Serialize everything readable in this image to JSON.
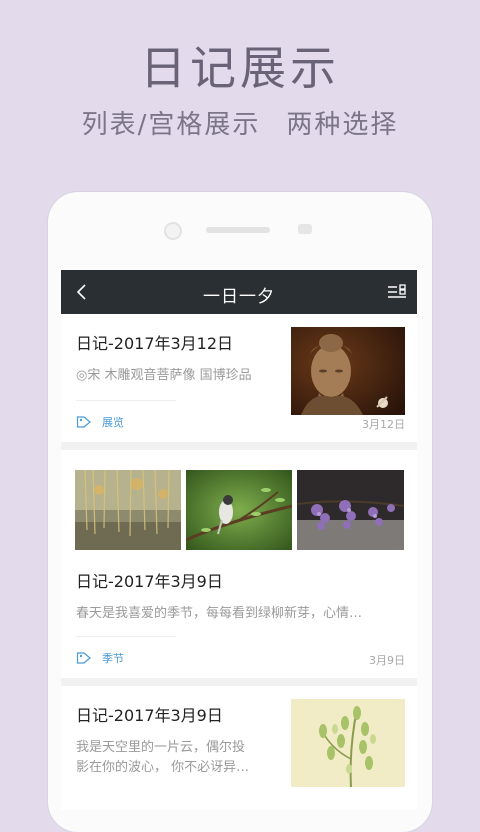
{
  "promo": {
    "title": "日记展示",
    "subtitle_left": "列表/宫格展示",
    "subtitle_right": "两种选择"
  },
  "app": {
    "title": "一日一夕"
  },
  "entries": [
    {
      "title": "日记-2017年3月12日",
      "excerpt": "◎宋 木雕观音菩萨像 国博珍品",
      "tag": "展览",
      "date": "3月12日",
      "image": "buddha-statue-photo"
    },
    {
      "title": "日记-2017年3月9日",
      "excerpt": "春天是我喜爱的季节，每每看到绿柳新芽，心情…",
      "tag": "季节",
      "date": "3月9日",
      "images": [
        "willow-trees-photo",
        "bird-on-branch-photo",
        "wisteria-flowers-photo"
      ]
    },
    {
      "title": "日记-2017年3月9日",
      "excerpt_line1": "我是天空里的一片云，偶尔投",
      "excerpt_line2": "影在你的波心，  你不必讶异…",
      "image": "green-plant-photo"
    }
  ],
  "colors": {
    "background": "#e3dbeb",
    "appbar": "#2a2f33",
    "tag": "#4a9bd6"
  }
}
